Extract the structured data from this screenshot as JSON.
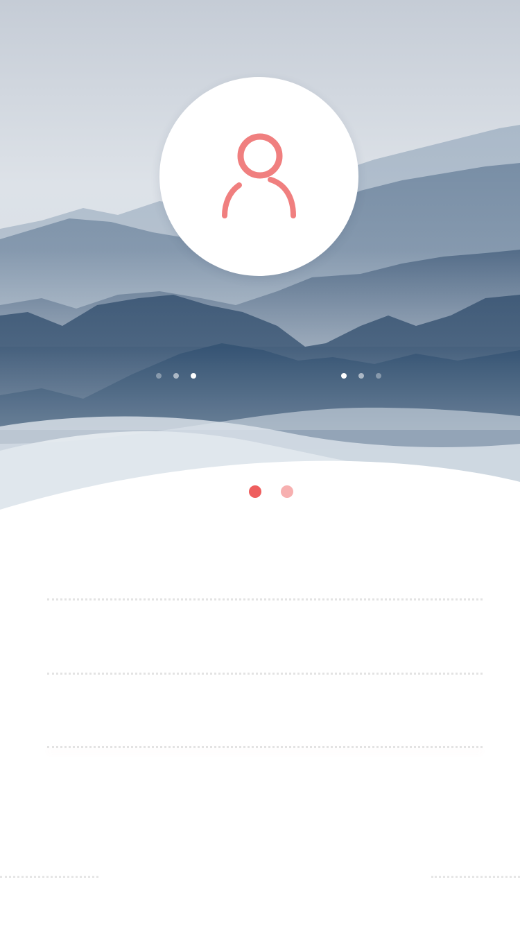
{
  "colors": {
    "accent": "#ee5e5e",
    "accent_light": "#f7b0b0",
    "icon_stroke": "#f07f7f",
    "sky_top": "#c9d1da",
    "mountain_dark": "#3e5a78",
    "background": "#ffffff"
  },
  "header": {
    "avatar_icon": "user-icon"
  },
  "hero_dots": {
    "left_active_index": 2,
    "right_active_index": 0
  },
  "pager": {
    "count": 2,
    "active_index": 0
  },
  "form": {
    "fields": [
      {
        "value": "",
        "placeholder": ""
      },
      {
        "value": "",
        "placeholder": ""
      },
      {
        "value": "",
        "placeholder": ""
      }
    ]
  }
}
